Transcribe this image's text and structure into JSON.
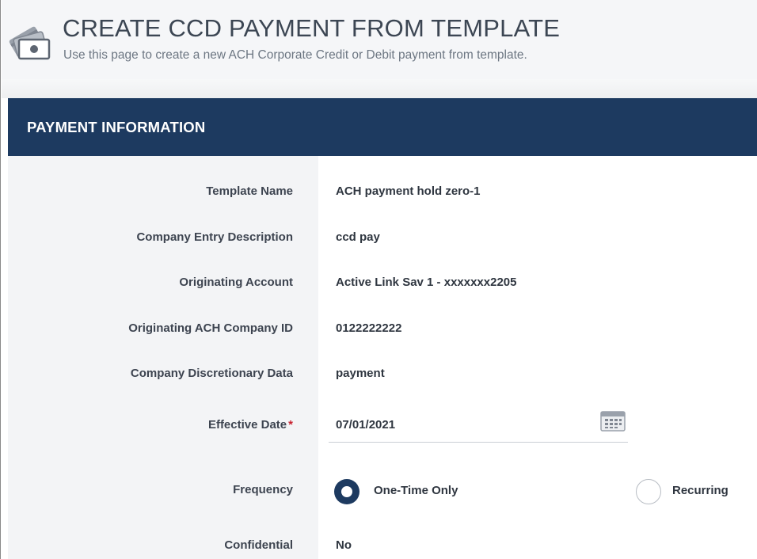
{
  "header": {
    "title": "CREATE CCD PAYMENT FROM TEMPLATE",
    "subtitle": "Use this page to create a new ACH Corporate Credit or Debit payment from template.",
    "icon": "payment-cards-icon"
  },
  "section": {
    "title": "PAYMENT INFORMATION"
  },
  "fields": {
    "template_name": {
      "label": "Template Name",
      "value": "ACH payment hold zero-1"
    },
    "company_entry_description": {
      "label": "Company Entry Description",
      "value": "ccd pay"
    },
    "originating_account": {
      "label": "Originating Account",
      "value": "Active Link Sav 1 - xxxxxxx2205"
    },
    "originating_ach_company_id": {
      "label": "Originating ACH Company ID",
      "value": "0122222222"
    },
    "company_discretionary_data": {
      "label": "Company Discretionary Data",
      "value": "payment"
    },
    "effective_date": {
      "label": "Effective Date",
      "required_mark": "*",
      "value": "07/01/2021",
      "icon": "calendar-icon"
    },
    "frequency": {
      "label": "Frequency",
      "options": [
        {
          "label": "One-Time Only",
          "selected": true
        },
        {
          "label": "Recurring",
          "selected": false
        }
      ]
    },
    "confidential": {
      "label": "Confidential",
      "value": "No"
    }
  },
  "colors": {
    "section_bar": "#1d3a60",
    "label_bg": "#f3f4f6",
    "required": "#c8202e"
  }
}
